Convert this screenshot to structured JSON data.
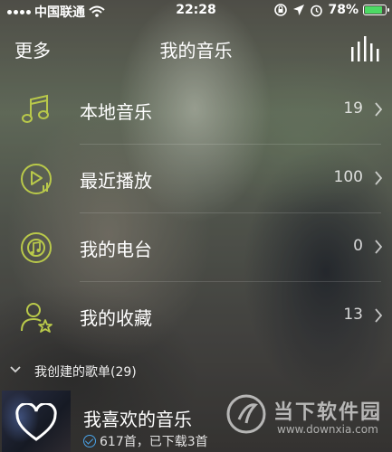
{
  "status_bar": {
    "carrier": "中国联通",
    "time": "22:28",
    "battery_percent": "78%",
    "battery_level": 0.78,
    "battery_color": "#4cd964"
  },
  "nav": {
    "more_label": "更多",
    "title": "我的音乐",
    "right_icon": "equalizer-bars-icon"
  },
  "menu": [
    {
      "label": "本地音乐",
      "count": "19",
      "icon": "music-note-icon"
    },
    {
      "label": "最近播放",
      "count": "100",
      "icon": "recent-play-icon"
    },
    {
      "label": "我的电台",
      "count": "0",
      "icon": "radio-icon"
    },
    {
      "label": "我的收藏",
      "count": "13",
      "icon": "favorite-user-icon"
    }
  ],
  "section": {
    "label": "我创建的歌单(29)"
  },
  "playlist": {
    "title": "我喜欢的音乐",
    "subtitle": "617首，已下载3首"
  },
  "watermark": {
    "name": "当下软件园",
    "url": "www.downxia.com"
  },
  "colors": {
    "accent_green": "#b9c94a",
    "download_blue": "#4aa3e8"
  }
}
